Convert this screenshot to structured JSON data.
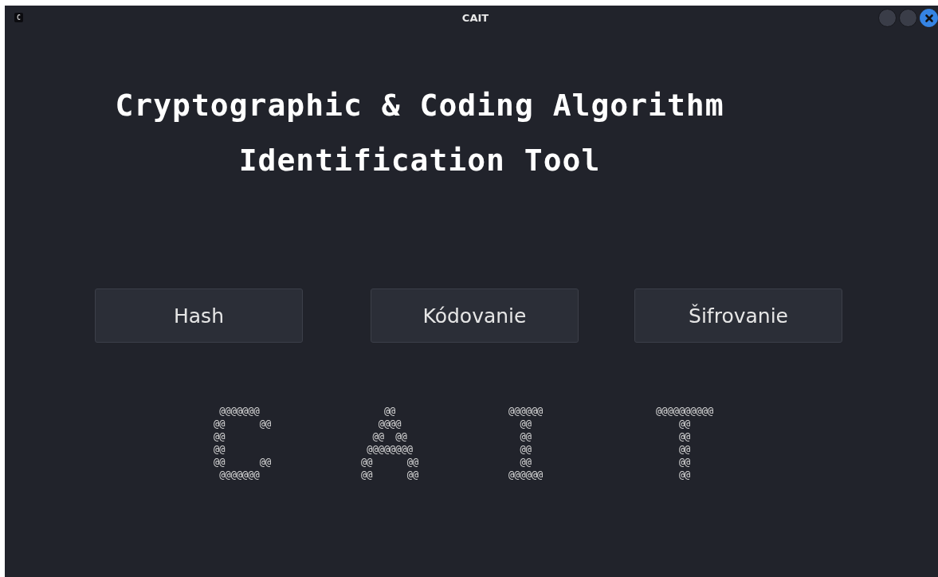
{
  "window": {
    "icon_letter": "C",
    "title": "CAIT"
  },
  "heading": [
    "Cryptographic & Coding Algorithm",
    "Identification Tool"
  ],
  "buttons": [
    "Hash",
    "Kódovanie",
    "Šifrovanie"
  ],
  "ascii_art": [
    {
      "lines": [
        " @@@@@@@",
        "@@      @@",
        "@@",
        "@@",
        "@@      @@",
        " @@@@@@@"
      ]
    },
    {
      "lines": [
        "    @@",
        "   @@@@",
        "  @@  @@",
        " @@@@@@@@",
        "@@      @@",
        "@@      @@"
      ]
    },
    {
      "lines": [
        "@@@@@@",
        "  @@",
        "  @@",
        "  @@",
        "  @@",
        "@@@@@@"
      ]
    },
    {
      "lines": [
        "@@@@@@@@@@",
        "    @@",
        "    @@",
        "    @@",
        "    @@",
        "    @@"
      ]
    }
  ]
}
